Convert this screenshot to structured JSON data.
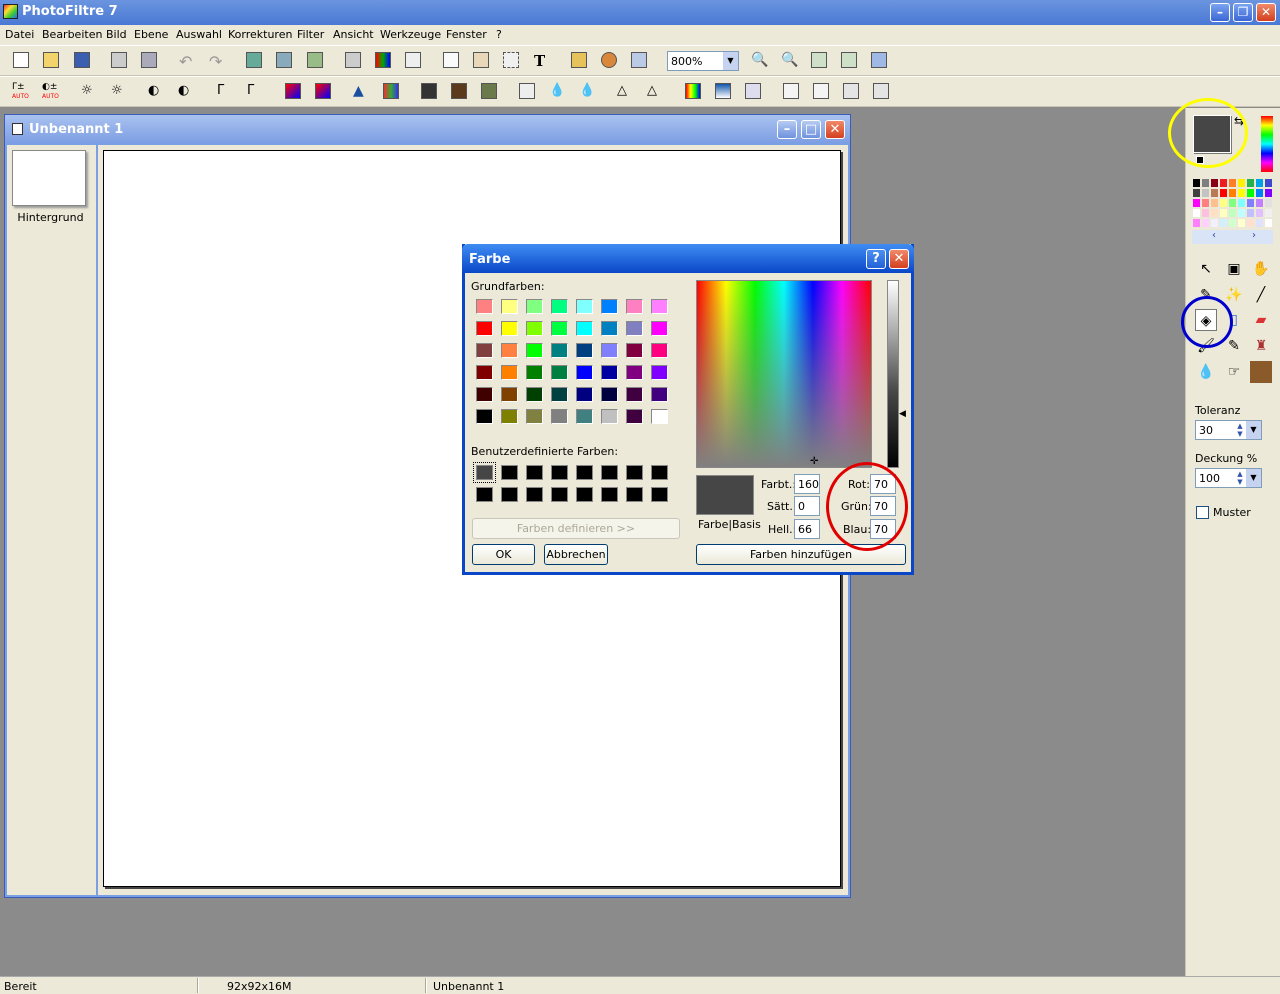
{
  "app": {
    "title": "PhotoFiltre 7"
  },
  "menu": {
    "items": [
      "Datei",
      "Bearbeiten",
      "Bild",
      "Ebene",
      "Auswahl",
      "Korrekturen",
      "Filter",
      "Ansicht",
      "Werkzeuge",
      "Fenster",
      "?"
    ]
  },
  "toolbar": {
    "zoom": "800%"
  },
  "document": {
    "title": "Unbenannt 1",
    "layer_label": "Hintergrund"
  },
  "right_panel": {
    "fg_color": "#464646",
    "bg_color": "#000000",
    "tolerance_label": "Toleranz",
    "tolerance_value": "30",
    "opacity_label": "Deckung %",
    "opacity_value": "100",
    "pattern_label": "Muster"
  },
  "dialog": {
    "title": "Farbe",
    "help_label": "?",
    "basic_label": "Grundfarben:",
    "custom_label": "Benutzerdefinierte Farben:",
    "define_label": "Farben definieren >>",
    "ok_label": "OK",
    "cancel_label": "Abbrechen",
    "add_label": "Farben hinzufügen",
    "preview_label": "Farbe|Basis",
    "hue_label": "Farbt.:",
    "hue_value": "160",
    "sat_label": "Sätt.:",
    "sat_value": "0",
    "lum_label": "Hell.:",
    "lum_value": "66",
    "red_label": "Rot:",
    "red_value": "70",
    "green_label": "Grün:",
    "green_value": "70",
    "blue_label": "Blau:",
    "blue_value": "70",
    "basic_colors": [
      "#ff8080",
      "#ffff80",
      "#80ff80",
      "#00ff80",
      "#80ffff",
      "#0080ff",
      "#ff80c0",
      "#ff80ff",
      "#ff0000",
      "#ffff00",
      "#80ff00",
      "#00ff40",
      "#00ffff",
      "#0080c0",
      "#8080c0",
      "#ff00ff",
      "#804040",
      "#ff8040",
      "#00ff00",
      "#008080",
      "#004080",
      "#8080ff",
      "#800040",
      "#ff0080",
      "#800000",
      "#ff8000",
      "#008000",
      "#008040",
      "#0000ff",
      "#0000a0",
      "#800080",
      "#8000ff",
      "#400000",
      "#804000",
      "#004000",
      "#004040",
      "#000080",
      "#000040",
      "#400040",
      "#400080",
      "#000000",
      "#808000",
      "#808040",
      "#808080",
      "#408080",
      "#c0c0c0",
      "#400040",
      "#ffffff"
    ]
  },
  "status": {
    "text": "Bereit",
    "size": "92x92x16M",
    "doc": "Unbenannt 1"
  },
  "colors": {
    "annotation_yellow": "#ffff00",
    "annotation_blue": "#0000cc",
    "annotation_red": "#e00000"
  }
}
